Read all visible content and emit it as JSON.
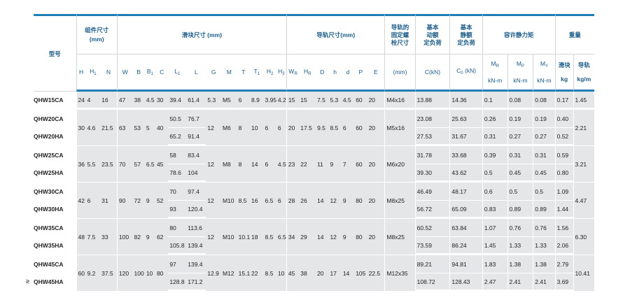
{
  "headers": {
    "model": "型号",
    "assembly": "组件尺寸\n(mm)",
    "block": "滑块尺寸 (mm)",
    "rail": "导轨尺寸(mm)",
    "rail_bolt": "导轨的\n固定螺\n栓尺寸",
    "dyn": "基本\n动额\n定负荷",
    "stat": "基本\n静额\n定负荷",
    "moment": "容许静力矩",
    "weight": "重量",
    "weight_block": "滑块",
    "weight_rail": "导轨",
    "mr": "M",
    "mr_sub": "R",
    "mp": "M",
    "mp_sub": "P",
    "my": "M",
    "my_sub": "Y",
    "knm": "kN-m",
    "kg": "kg",
    "kgm": "kg/m",
    "mm": "(mm)",
    "c_kn": "C(kN)",
    "c0": "C",
    "c0_sub": "0",
    "c0_unit": " (kN)"
  },
  "sub_columns": [
    {
      "t": "H"
    },
    {
      "t": "H",
      "s": "1"
    },
    {
      "t": "N"
    },
    {
      "t": "W"
    },
    {
      "t": "B"
    },
    {
      "t": "B",
      "s": "1"
    },
    {
      "t": "C"
    },
    {
      "t": "L",
      "s": "1"
    },
    {
      "t": "L"
    },
    {
      "t": "G"
    },
    {
      "t": "M"
    },
    {
      "t": "T"
    },
    {
      "t": "T",
      "s": "1"
    },
    {
      "t": "H",
      "s": "2"
    },
    {
      "t": "H",
      "s": "3"
    },
    {
      "t": "W",
      "s": "R"
    },
    {
      "t": "H",
      "s": "R"
    },
    {
      "t": "D"
    },
    {
      "t": "h"
    },
    {
      "t": "d"
    },
    {
      "t": "P"
    },
    {
      "t": "E"
    }
  ],
  "groups": [
    {
      "shared": {
        "H": "24",
        "H1": "4",
        "N": "16",
        "W": "47",
        "B": "38",
        "B1": "4.5",
        "C": "30",
        "G": "5.3",
        "M": "M5",
        "T": "6",
        "T1": "8.9",
        "H2": "3.95",
        "H3": "4.2",
        "WR": "15",
        "HR": "15",
        "D": "7.5",
        "h": "5.3",
        "d": "4.5",
        "P": "60",
        "E": "20",
        "bolt": "M4x16",
        "rail_w": "1.45"
      },
      "rows": [
        {
          "model": "QHW15CA",
          "L1": "39.4",
          "L": "61.4",
          "C": "13.88",
          "C0": "14.36",
          "MR": "0.1",
          "MP": "0.08",
          "MY": "0.08",
          "kg": "0.17"
        }
      ]
    },
    {
      "shared": {
        "H": "30",
        "H1": "4.6",
        "N": "21.5",
        "W": "63",
        "B": "53",
        "B1": "5",
        "C": "40",
        "G": "12",
        "M": "M6",
        "T": "8",
        "T1": "10",
        "H2": "6",
        "H3": "6",
        "WR": "20",
        "HR": "17.5",
        "D": "9.5",
        "h": "8.5",
        "d": "6",
        "P": "60",
        "E": "20",
        "bolt": "M5x16",
        "rail_w": "2.21"
      },
      "rows": [
        {
          "model": "QHW20CA",
          "L1": "50.5",
          "L": "76.7",
          "C": "23.08",
          "C0": "25.63",
          "MR": "0.26",
          "MP": "0.19",
          "MY": "0.19",
          "kg": "0.40"
        },
        {
          "model": "QHW20HA",
          "L1": "65.2",
          "L": "91.4",
          "C": "27.53",
          "C0": "31.67",
          "MR": "0.31",
          "MP": "0.27",
          "MY": "0.27",
          "kg": "0.52"
        }
      ]
    },
    {
      "shared": {
        "H": "36",
        "H1": "5.5",
        "N": "23.5",
        "W": "70",
        "B": "57",
        "B1": "6.5",
        "C": "45",
        "G": "12",
        "M": "M8",
        "T": "8",
        "T1": "14",
        "H2": "6",
        "H3": "4.5",
        "WR": "23",
        "HR": "22",
        "D": "11",
        "h": "9",
        "d": "7",
        "P": "60",
        "E": "20",
        "bolt": "M6x20",
        "rail_w": "3.21"
      },
      "rows": [
        {
          "model": "QHW25CA",
          "L1": "58",
          "L": "83.4",
          "C": "31.78",
          "C0": "33.68",
          "MR": "0.39",
          "MP": "0.31",
          "MY": "0.31",
          "kg": "0.59"
        },
        {
          "model": "QHW25HA",
          "L1": "78.6",
          "L": "104",
          "C": "39.30",
          "C0": "43.62",
          "MR": "0.5",
          "MP": "0.45",
          "MY": "0.45",
          "kg": "0.80"
        }
      ]
    },
    {
      "shared": {
        "H": "42",
        "H1": "6",
        "N": "31",
        "W": "90",
        "B": "72",
        "B1": "9",
        "C": "52",
        "G": "12",
        "M": "M10",
        "T": "8.5",
        "T1": "16",
        "H2": "6.5",
        "H3": "6",
        "WR": "28",
        "HR": "26",
        "D": "14",
        "h": "12",
        "d": "9",
        "P": "80",
        "E": "20",
        "bolt": "M8x25",
        "rail_w": "4.47"
      },
      "rows": [
        {
          "model": "QHW30CA",
          "L1": "70",
          "L": "97.4",
          "C": "46.49",
          "C0": "48.17",
          "MR": "0.6",
          "MP": "0.5",
          "MY": "0.5",
          "kg": "1.09"
        },
        {
          "model": "QHW30HA",
          "L1": "93",
          "L": "120.4",
          "C": "56.72",
          "C0": "65.09",
          "MR": "0.83",
          "MP": "0.89",
          "MY": "0.89",
          "kg": "1.44"
        }
      ]
    },
    {
      "shared": {
        "H": "48",
        "H1": "7.5",
        "N": "33",
        "W": "100",
        "B": "82",
        "B1": "9",
        "C": "62",
        "G": "12",
        "M": "M10",
        "T": "10.1",
        "T1": "18",
        "H2": "8.5",
        "H3": "6.5",
        "WR": "34",
        "HR": "29",
        "D": "14",
        "h": "12",
        "d": "9",
        "P": "80",
        "E": "20",
        "bolt": "M8x25",
        "rail_w": "6.30"
      },
      "rows": [
        {
          "model": "QHW35CA",
          "L1": "80",
          "L": "113.6",
          "C": "60.52",
          "C0": "63.84",
          "MR": "1.07",
          "MP": "0.76",
          "MY": "0.76",
          "kg": "1.56"
        },
        {
          "model": "QHW35HA",
          "L1": "105.8",
          "L": "139.4",
          "C": "73.59",
          "C0": "86.24",
          "MR": "1.45",
          "MP": "1.33",
          "MY": "1.33",
          "kg": "2.06"
        }
      ]
    },
    {
      "shared": {
        "H": "60",
        "H1": "9.2",
        "N": "37.5",
        "W": "120",
        "B": "100",
        "B1": "10",
        "C": "80",
        "G": "12.9",
        "M": "M12",
        "T": "15.1",
        "T1": "22",
        "H2": "8.5",
        "H3": "10",
        "WR": "45",
        "HR": "38",
        "D": "20",
        "h": "17",
        "d": "14",
        "P": "105",
        "E": "22.5",
        "bolt": "M12x35",
        "rail_w": "10.41"
      },
      "rows": [
        {
          "model": "QHW45CA",
          "L1": "97",
          "L": "139.4",
          "C": "89.21",
          "C0": "94.81",
          "MR": "1.83",
          "MP": "1.38",
          "MY": "1.38",
          "kg": "2.79"
        },
        {
          "model": "QHW45HA",
          "L1": "128.8",
          "L": "171.2",
          "C": "108.72",
          "C0": "128.43",
          "MR": "2.47",
          "MP": "2.41",
          "MY": "2.41",
          "kg": "3.69"
        }
      ]
    }
  ],
  "corner_mark": "≷"
}
